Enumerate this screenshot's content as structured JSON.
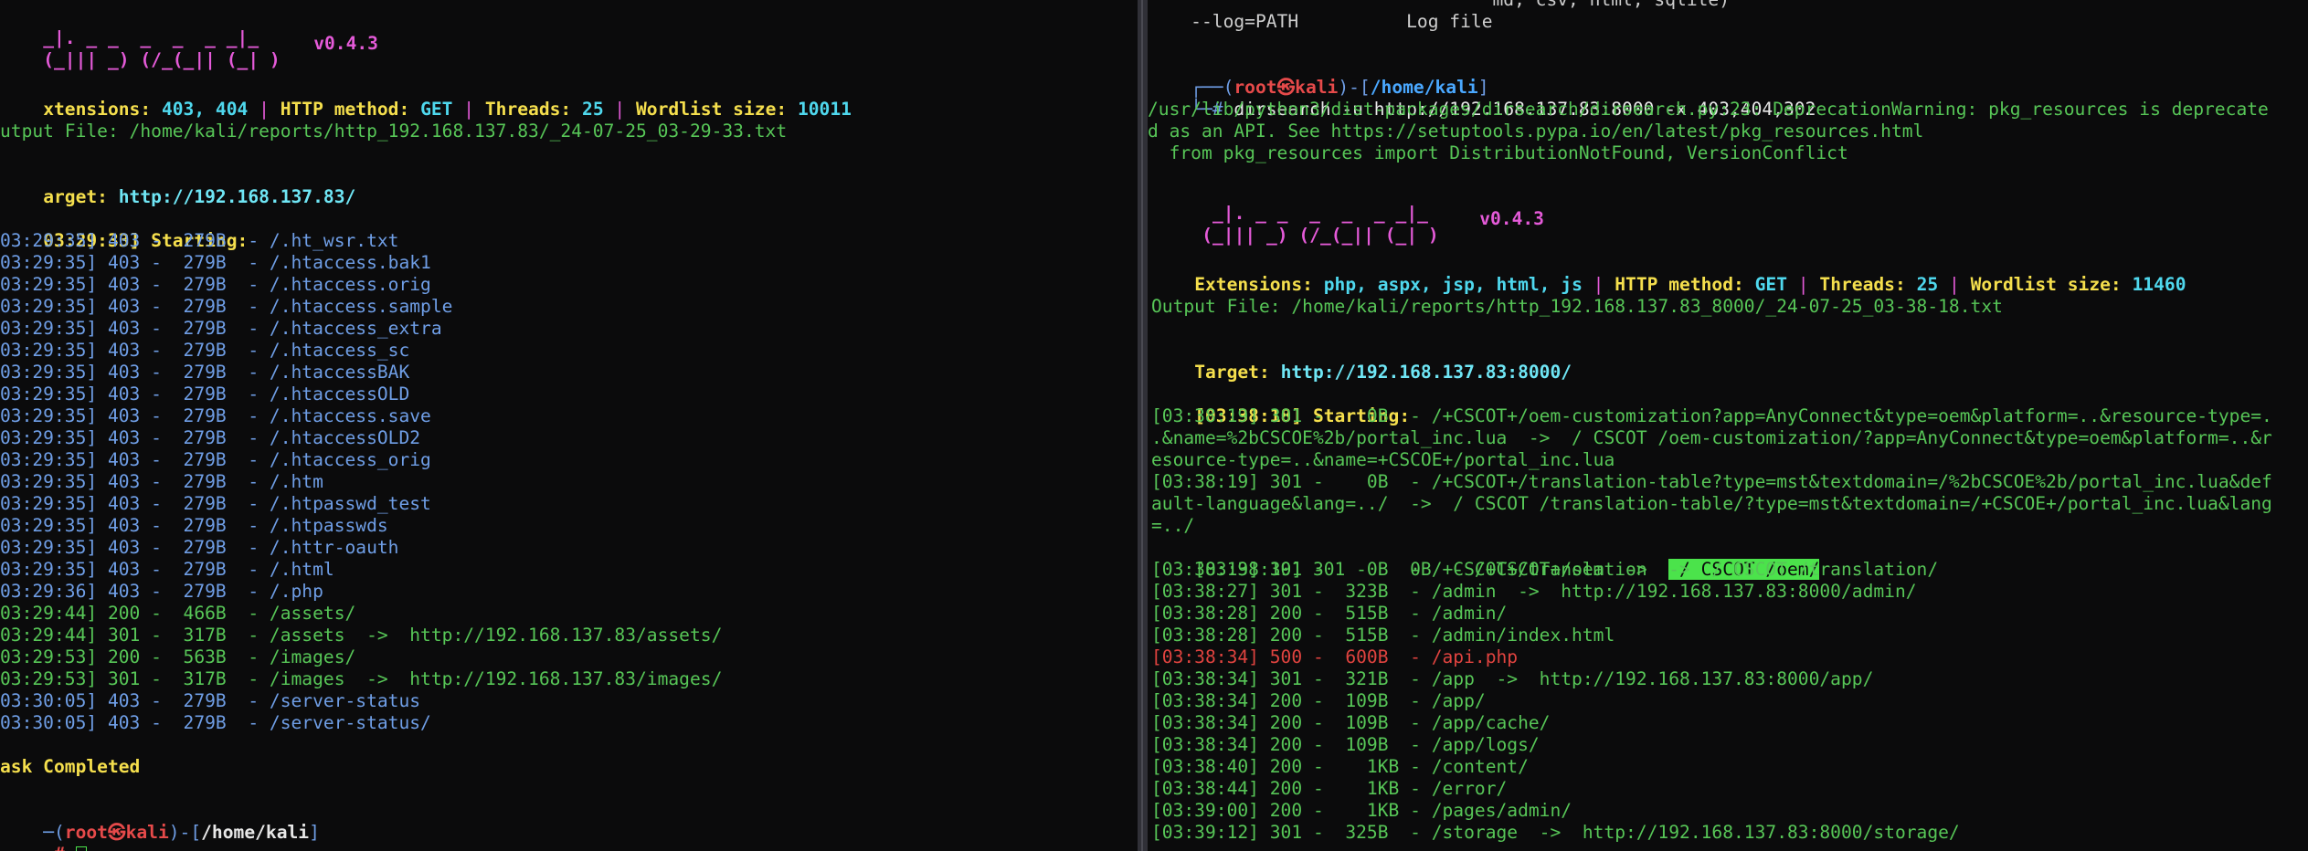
{
  "left": {
    "version": "v0.4.3",
    "banner1": "_|. _ _  _  _  _ _|_",
    "banner2": "(_||| _) (/_(_|| (_| )",
    "extensions_label": "xtensions: ",
    "extensions": "403, 404",
    "method_label": "HTTP method: ",
    "method": "GET",
    "threads_label": "Threads: ",
    "threads": "25",
    "wordlist_label": "Wordlist size: ",
    "wordlist": "10011",
    "output_file": "utput File: /home/kali/reports/http_192.168.137.83/_24-07-25_03-29-33.txt",
    "target_label": "arget: ",
    "target": "http://192.168.137.83/",
    "start_time": "03:29:33]",
    "start_label": " Starting:",
    "entries": [
      {
        "text": "03:29:35] 403 -  279B  - /.ht_wsr.txt",
        "c": "blue"
      },
      {
        "text": "03:29:35] 403 -  279B  - /.htaccess.bak1",
        "c": "blue"
      },
      {
        "text": "03:29:35] 403 -  279B  - /.htaccess.orig",
        "c": "blue"
      },
      {
        "text": "03:29:35] 403 -  279B  - /.htaccess.sample",
        "c": "blue"
      },
      {
        "text": "03:29:35] 403 -  279B  - /.htaccess_extra",
        "c": "blue"
      },
      {
        "text": "03:29:35] 403 -  279B  - /.htaccess_sc",
        "c": "blue"
      },
      {
        "text": "03:29:35] 403 -  279B  - /.htaccessBAK",
        "c": "blue"
      },
      {
        "text": "03:29:35] 403 -  279B  - /.htaccessOLD",
        "c": "blue"
      },
      {
        "text": "03:29:35] 403 -  279B  - /.htaccess.save",
        "c": "blue"
      },
      {
        "text": "03:29:35] 403 -  279B  - /.htaccessOLD2",
        "c": "blue"
      },
      {
        "text": "03:29:35] 403 -  279B  - /.htaccess_orig",
        "c": "blue"
      },
      {
        "text": "03:29:35] 403 -  279B  - /.htm",
        "c": "blue"
      },
      {
        "text": "03:29:35] 403 -  279B  - /.htpasswd_test",
        "c": "blue"
      },
      {
        "text": "03:29:35] 403 -  279B  - /.htpasswds",
        "c": "blue"
      },
      {
        "text": "03:29:35] 403 -  279B  - /.httr-oauth",
        "c": "blue"
      },
      {
        "text": "03:29:35] 403 -  279B  - /.html",
        "c": "blue"
      },
      {
        "text": "03:29:36] 403 -  279B  - /.php",
        "c": "blue"
      },
      {
        "text": "03:29:44] 200 -  466B  - /assets/",
        "c": "green"
      },
      {
        "text": "03:29:44] 301 -  317B  - /assets  ->  http://192.168.137.83/assets/",
        "c": "green"
      },
      {
        "text": "03:29:53] 200 -  563B  - /images/",
        "c": "green"
      },
      {
        "text": "03:29:53] 301 -  317B  - /images  ->  http://192.168.137.83/images/",
        "c": "green"
      },
      {
        "text": "03:30:05] 403 -  279B  - /server-status",
        "c": "blue"
      },
      {
        "text": "03:30:05] 403 -  279B  - /server-status/",
        "c": "blue"
      }
    ],
    "task_completed": "ask Completed",
    "prompt_user": "root",
    "prompt_at": "㉿",
    "prompt_host": "kali",
    "prompt_dir": "/home/kali",
    "prompt_pre": "─(",
    "prompt_mid": ")-[",
    "prompt_end": "]",
    "prompt_hash": "-# "
  },
  "right": {
    "help_top": "                                md, csv, html, sqlite)",
    "help_log": "    --log=PATH          Log file",
    "prompt_pre": "┌──(",
    "prompt_user": "root",
    "prompt_at": "㉿",
    "prompt_host": "kali",
    "prompt_mid": ")-[",
    "prompt_dir": "/home/kali",
    "prompt_end": "]",
    "prompt_hash": "└─# ",
    "command": "dirsearch -u http://192.168.137.83:8000 -x 403,404,302",
    "warning1": "/usr/lib/python3/dist-packages/dirsearch/dirsearch.py:23: DeprecationWarning: pkg_resources is deprecate",
    "warning2": "d as an API. See https://setuptools.pypa.io/en/latest/pkg_resources.html",
    "warning3": "  from pkg_resources import DistributionNotFound, VersionConflict",
    "banner1": " _|. _ _  _  _  _ _|_",
    "banner2": "(_||| _) (/_(_|| (_| )",
    "version": "v0.4.3",
    "extensions_label": "Extensions: ",
    "extensions": "php, aspx, jsp, html, js",
    "method_label": "HTTP method: ",
    "method": "GET",
    "threads_label": "Threads: ",
    "threads": "25",
    "wordlist_label": "Wordlist size: ",
    "wordlist": "11460",
    "output_file": "Output File: /home/kali/reports/http_192.168.137.83_8000/_24-07-25_03-38-18.txt",
    "target_label": "Target: ",
    "target": "http://192.168.137.83:8000/",
    "start_time": "[03:38:18]",
    "start_label": " Starting:",
    "cscot1": "[03:38:19] 301 -    0B  - /+CSCOT+/oem-customization?app=AnyConnect&type=oem&platform=..&resource-type=.",
    "cscot2": ".&name=%2bCSCOE%2b/portal_inc.lua  ->  / CSCOT /oem-customization/?app=AnyConnect&type=oem&platform=..&r",
    "cscot3": "esource-type=..&name=+CSCOE+/portal_inc.lua",
    "cscot4": "[03:38:19] 301 -    0B  - /+CSCOT+/translation-table?type=mst&textdomain=/%2bCSCOE%2b/portal_inc.lua&def",
    "cscot5": "ault-language&lang=../  ->  / CSCOT /translation-table/?type=mst&textdomain=/+CSCOE+/portal_inc.lua&lang",
    "cscot6": "=../",
    "oem_pre": "[03:38:19] 301 -    0B  - /+CSCOT+/oem  ->  ",
    "oem_hl": " / CSCOT /oem/",
    "entries": [
      {
        "text": "[03:38:19] 301 -    0B  - /+CSCOT+/translation  ->  / CSCOT /translation/",
        "c": "green"
      },
      {
        "text": "[03:38:27] 301 -  323B  - /admin  ->  http://192.168.137.83:8000/admin/",
        "c": "green"
      },
      {
        "text": "[03:38:28] 200 -  515B  - /admin/",
        "c": "green"
      },
      {
        "text": "[03:38:28] 200 -  515B  - /admin/index.html",
        "c": "green"
      },
      {
        "text": "[03:38:34] 500 -  600B  - /api.php",
        "c": "red"
      },
      {
        "text": "[03:38:34] 301 -  321B  - /app  ->  http://192.168.137.83:8000/app/",
        "c": "green"
      },
      {
        "text": "[03:38:34] 200 -  109B  - /app/",
        "c": "green"
      },
      {
        "text": "[03:38:34] 200 -  109B  - /app/cache/",
        "c": "green"
      },
      {
        "text": "[03:38:34] 200 -  109B  - /app/logs/",
        "c": "green"
      },
      {
        "text": "[03:38:40] 200 -    1KB - /content/",
        "c": "green"
      },
      {
        "text": "[03:38:44] 200 -    1KB - /error/",
        "c": "green"
      },
      {
        "text": "[03:39:00] 200 -    1KB - /pages/admin/",
        "c": "green"
      },
      {
        "text": "[03:39:12] 301 -  325B  - /storage  ->  http://192.168.137.83:8000/storage/",
        "c": "green"
      }
    ]
  }
}
